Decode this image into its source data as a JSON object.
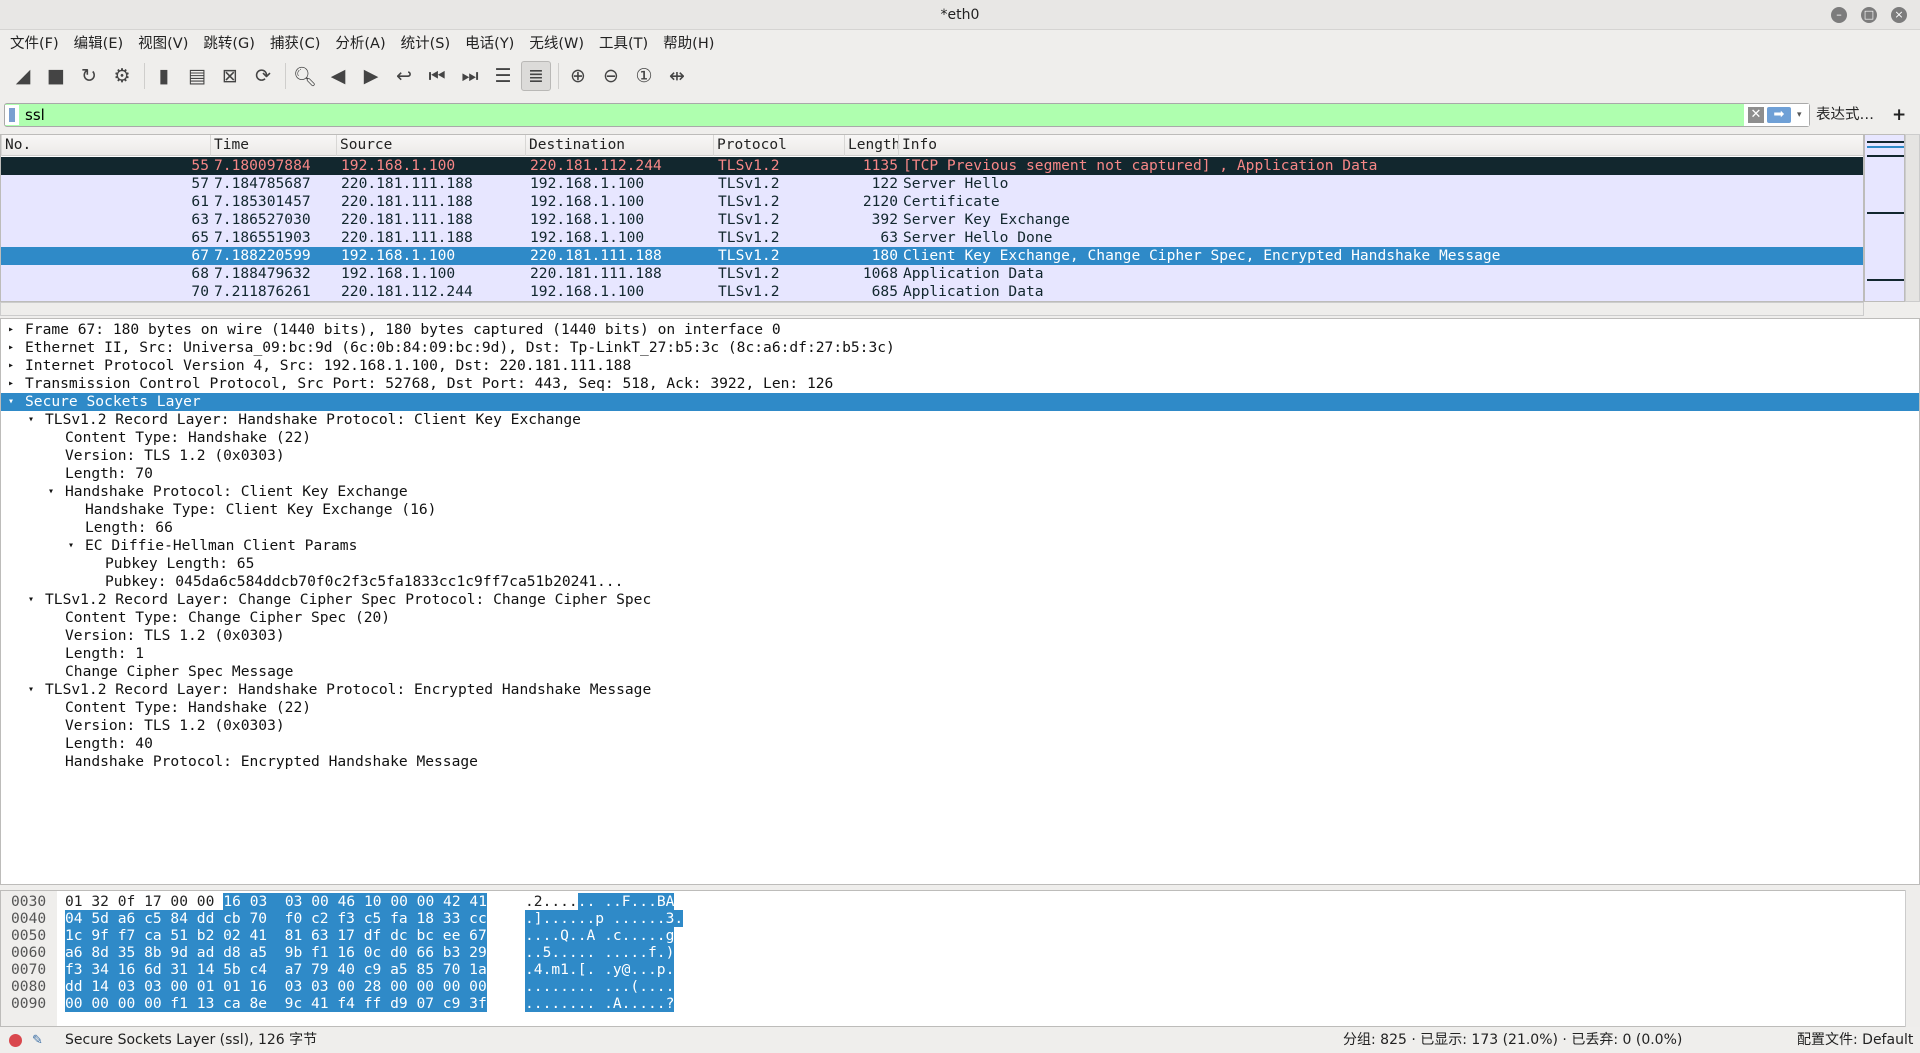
{
  "window": {
    "title": "*eth0",
    "min": "–",
    "max": "□",
    "close": "×"
  },
  "menu": [
    "文件(F)",
    "编辑(E)",
    "视图(V)",
    "跳转(G)",
    "捕获(C)",
    "分析(A)",
    "统计(S)",
    "电话(Y)",
    "无线(W)",
    "工具(T)",
    "帮助(H)"
  ],
  "toolbar": [
    {
      "icon": "shark-fin-start-icon",
      "glyph": "◢"
    },
    {
      "icon": "stop-icon",
      "glyph": "■"
    },
    {
      "icon": "restart-icon",
      "glyph": "↻"
    },
    {
      "icon": "capture-options-icon",
      "glyph": "⚙"
    },
    {
      "sep": true
    },
    {
      "icon": "open-file-icon",
      "glyph": "▮"
    },
    {
      "icon": "save-file-icon",
      "glyph": "▤"
    },
    {
      "icon": "close-file-icon",
      "glyph": "⊠"
    },
    {
      "icon": "reload-file-icon",
      "glyph": "⟳"
    },
    {
      "sep": true
    },
    {
      "icon": "find-packet-icon",
      "glyph": "🔍︎"
    },
    {
      "icon": "go-back-icon",
      "glyph": "◀"
    },
    {
      "icon": "go-forward-icon",
      "glyph": "▶"
    },
    {
      "icon": "go-to-packet-icon",
      "glyph": "↩"
    },
    {
      "icon": "first-packet-icon",
      "glyph": "⏮"
    },
    {
      "icon": "last-packet-icon",
      "glyph": "⏭"
    },
    {
      "icon": "autoscroll-icon",
      "glyph": "☰"
    },
    {
      "icon": "colorize-icon",
      "glyph": "≣",
      "active": true
    },
    {
      "sep": true
    },
    {
      "icon": "zoom-in-icon",
      "glyph": "⊕"
    },
    {
      "icon": "zoom-out-icon",
      "glyph": "⊖"
    },
    {
      "icon": "zoom-normal-icon",
      "glyph": "①"
    },
    {
      "icon": "resize-columns-icon",
      "glyph": "⇹"
    }
  ],
  "filter": {
    "value": "ssl",
    "clear": "✕",
    "apply": "➡",
    "dropdown": "▾",
    "expression_label": "表达式…",
    "add_label": "+",
    "color": "#afffaf"
  },
  "packet_list": {
    "columns": [
      "No.",
      "Time",
      "Source",
      "Destination",
      "Protocol",
      "Length",
      "Info"
    ],
    "rows": [
      {
        "no": "55",
        "time": "7.180097884",
        "src": "192.168.1.100",
        "dst": "220.181.112.244",
        "proto": "TLSv1.2",
        "len": "1135",
        "info": "[TCP Previous segment not captured] , Application Data",
        "style": "bad"
      },
      {
        "no": "57",
        "time": "7.184785687",
        "src": "220.181.111.188",
        "dst": "192.168.1.100",
        "proto": "TLSv1.2",
        "len": "122",
        "info": "Server Hello",
        "style": ""
      },
      {
        "no": "61",
        "time": "7.185301457",
        "src": "220.181.111.188",
        "dst": "192.168.1.100",
        "proto": "TLSv1.2",
        "len": "2120",
        "info": "Certificate",
        "style": ""
      },
      {
        "no": "63",
        "time": "7.186527030",
        "src": "220.181.111.188",
        "dst": "192.168.1.100",
        "proto": "TLSv1.2",
        "len": "392",
        "info": "Server Key Exchange",
        "style": ""
      },
      {
        "no": "65",
        "time": "7.186551903",
        "src": "220.181.111.188",
        "dst": "192.168.1.100",
        "proto": "TLSv1.2",
        "len": "63",
        "info": "Server Hello Done",
        "style": ""
      },
      {
        "no": "67",
        "time": "7.188220599",
        "src": "192.168.1.100",
        "dst": "220.181.111.188",
        "proto": "TLSv1.2",
        "len": "180",
        "info": "Client Key Exchange, Change Cipher Spec, Encrypted Handshake Message",
        "style": "sel"
      },
      {
        "no": "68",
        "time": "7.188479632",
        "src": "192.168.1.100",
        "dst": "220.181.111.188",
        "proto": "TLSv1.2",
        "len": "1068",
        "info": "Application Data",
        "style": ""
      },
      {
        "no": "70",
        "time": "7.211876261",
        "src": "220.181.112.244",
        "dst": "192.168.1.100",
        "proto": "TLSv1.2",
        "len": "685",
        "info": "Application Data",
        "style": ""
      }
    ],
    "colors": {
      "default_bg": "#e7e6ff",
      "bad_bg": "#12272e",
      "bad_fg": "#f78787",
      "selected_bg": "#2f8ac8"
    }
  },
  "details": [
    {
      "level": 0,
      "arrow": "▸",
      "text": "Frame 67: 180 bytes on wire (1440 bits), 180 bytes captured (1440 bits) on interface 0"
    },
    {
      "level": 0,
      "arrow": "▸",
      "text": "Ethernet II, Src: Universa_09:bc:9d (6c:0b:84:09:bc:9d), Dst: Tp-LinkT_27:b5:3c (8c:a6:df:27:b5:3c)"
    },
    {
      "level": 0,
      "arrow": "▸",
      "text": "Internet Protocol Version 4, Src: 192.168.1.100, Dst: 220.181.111.188"
    },
    {
      "level": 0,
      "arrow": "▸",
      "text": "Transmission Control Protocol, Src Port: 52768, Dst Port: 443, Seq: 518, Ack: 3922, Len: 126"
    },
    {
      "level": 0,
      "arrow": "▾",
      "text": "Secure Sockets Layer",
      "selected": true
    },
    {
      "level": 1,
      "arrow": "▾",
      "text": "TLSv1.2 Record Layer: Handshake Protocol: Client Key Exchange"
    },
    {
      "level": 2,
      "arrow": "",
      "text": "Content Type: Handshake (22)"
    },
    {
      "level": 2,
      "arrow": "",
      "text": "Version: TLS 1.2 (0x0303)"
    },
    {
      "level": 2,
      "arrow": "",
      "text": "Length: 70"
    },
    {
      "level": 2,
      "arrow": "▾",
      "text": "Handshake Protocol: Client Key Exchange"
    },
    {
      "level": 3,
      "arrow": "",
      "text": "Handshake Type: Client Key Exchange (16)"
    },
    {
      "level": 3,
      "arrow": "",
      "text": "Length: 66"
    },
    {
      "level": 3,
      "arrow": "▾",
      "text": "EC Diffie-Hellman Client Params"
    },
    {
      "level": 4,
      "arrow": "",
      "text": "Pubkey Length: 65"
    },
    {
      "level": 4,
      "arrow": "",
      "text": "Pubkey: 045da6c584ddcb70f0c2f3c5fa1833cc1c9ff7ca51b20241..."
    },
    {
      "level": 1,
      "arrow": "▾",
      "text": "TLSv1.2 Record Layer: Change Cipher Spec Protocol: Change Cipher Spec"
    },
    {
      "level": 2,
      "arrow": "",
      "text": "Content Type: Change Cipher Spec (20)"
    },
    {
      "level": 2,
      "arrow": "",
      "text": "Version: TLS 1.2 (0x0303)"
    },
    {
      "level": 2,
      "arrow": "",
      "text": "Length: 1"
    },
    {
      "level": 2,
      "arrow": "",
      "text": "Change Cipher Spec Message"
    },
    {
      "level": 1,
      "arrow": "▾",
      "text": "TLSv1.2 Record Layer: Handshake Protocol: Encrypted Handshake Message"
    },
    {
      "level": 2,
      "arrow": "",
      "text": "Content Type: Handshake (22)"
    },
    {
      "level": 2,
      "arrow": "",
      "text": "Version: TLS 1.2 (0x0303)"
    },
    {
      "level": 2,
      "arrow": "",
      "text": "Length: 40"
    },
    {
      "level": 2,
      "arrow": "",
      "text": "Handshake Protocol: Encrypted Handshake Message"
    }
  ],
  "hex": [
    {
      "offset": "0030",
      "hex_plain": "01 32 0f 17 00 00 ",
      "hex_sel": "16 03  03 00 46 10 00 00 42 41",
      "ascii_plain": ".2....",
      "ascii_sel": ".. ..F...BA"
    },
    {
      "offset": "0040",
      "hex_plain": "",
      "hex_sel": "04 5d a6 c5 84 dd cb 70  f0 c2 f3 c5 fa 18 33 cc",
      "ascii_plain": "",
      "ascii_sel": ".]......p ......3."
    },
    {
      "offset": "0050",
      "hex_plain": "",
      "hex_sel": "1c 9f f7 ca 51 b2 02 41  81 63 17 df dc bc ee 67",
      "ascii_plain": "",
      "ascii_sel": "....Q..A .c.....g"
    },
    {
      "offset": "0060",
      "hex_plain": "",
      "hex_sel": "a6 8d 35 8b 9d ad d8 a5  9b f1 16 0c d0 66 b3 29",
      "ascii_plain": "",
      "ascii_sel": "..5..... .....f.)"
    },
    {
      "offset": "0070",
      "hex_plain": "",
      "hex_sel": "f3 34 16 6d 31 14 5b c4  a7 79 40 c9 a5 85 70 1a",
      "ascii_plain": "",
      "ascii_sel": ".4.m1.[. .y@...p."
    },
    {
      "offset": "0080",
      "hex_plain": "",
      "hex_sel": "dd 14 03 03 00 01 01 16  03 03 00 28 00 00 00 00",
      "ascii_plain": "",
      "ascii_sel": "........ ...(...."
    },
    {
      "offset": "0090",
      "hex_plain": "",
      "hex_sel": "00 00 00 00 f1 13 ca 8e  9c 41 f4 ff d9 07 c9 3f",
      "ascii_plain": "",
      "ascii_sel": "........ .A.....?"
    }
  ],
  "status": {
    "field": "Secure Sockets Layer (ssl), 126 字节",
    "counts": "分组: 825 · 已显示: 173 (21.0%) · 已丢弃: 0 (0.0%)",
    "profile": "配置文件: Default"
  }
}
